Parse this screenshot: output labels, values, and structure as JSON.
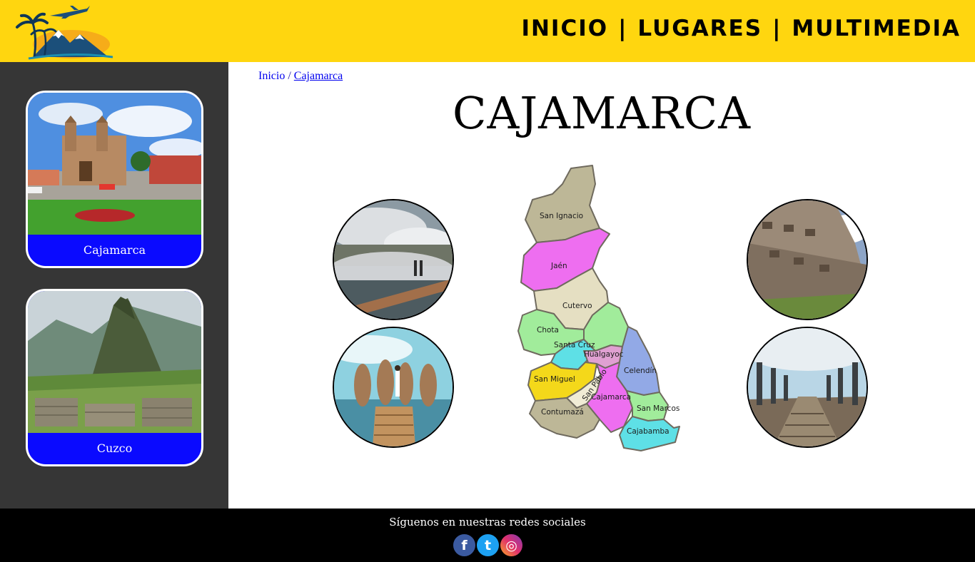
{
  "header": {
    "nav": [
      {
        "label": "INICIO"
      },
      {
        "label": "LUGARES"
      },
      {
        "label": "MULTIMEDIA"
      }
    ],
    "separator": "|"
  },
  "sidebar": {
    "cards": [
      {
        "label": "Cajamarca"
      },
      {
        "label": "Cuzco"
      }
    ]
  },
  "breadcrumb": {
    "home": "Inicio",
    "separator": "/",
    "current": "Cajamarca"
  },
  "main": {
    "title": "CAJAMARCA",
    "map": {
      "provinces": [
        "San Ignacio",
        "Jaén",
        "Cutervo",
        "Chota",
        "Santa Cruz",
        "Hualgayoc",
        "Celendín",
        "San Miguel",
        "San Pablo",
        "Cajamarca",
        "San Marcos",
        "Contumazá",
        "Cajabamba"
      ]
    }
  },
  "footer": {
    "text": "Síguenos en nuestras redes sociales",
    "social": [
      {
        "icon": "facebook-icon",
        "glyph": "f"
      },
      {
        "icon": "twitter-icon",
        "glyph": "t"
      },
      {
        "icon": "instagram-icon",
        "glyph": "◎"
      }
    ]
  },
  "colors": {
    "header_bg": "#ffd60f",
    "sidebar_bg": "#363636",
    "card_label_bg": "#0a0aff",
    "footer_bg": "#000000"
  }
}
